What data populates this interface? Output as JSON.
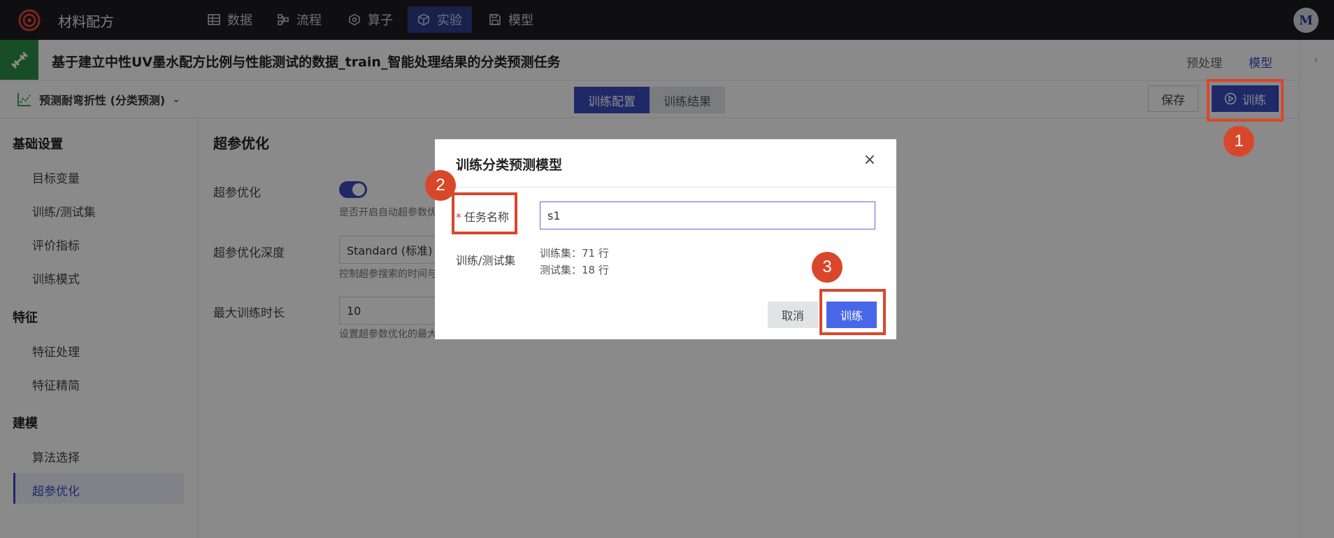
{
  "app": {
    "name": "材料配方",
    "avatar": "M"
  },
  "nav": [
    {
      "label": "数据",
      "icon": "table-icon"
    },
    {
      "label": "流程",
      "icon": "flow-icon"
    },
    {
      "label": "算子",
      "icon": "operator-icon"
    },
    {
      "label": "实验",
      "icon": "cube-icon",
      "active": true
    },
    {
      "label": "模型",
      "icon": "model-icon"
    }
  ],
  "titlebar": {
    "title": "基于建立中性UV墨水配方比例与性能测试的数据_train_智能处理结果的分类预测任务",
    "links": [
      "预处理",
      "模型"
    ],
    "active_link": "模型"
  },
  "toolbar": {
    "task_select": "预测耐弯折性 (分类预测)",
    "tabs": [
      "训练配置",
      "训练结果"
    ],
    "active_tab": "训练配置",
    "save": "保存",
    "train": "训练"
  },
  "sidebar": {
    "groups": [
      {
        "title": "基础设置",
        "items": [
          "目标变量",
          "训练/测试集",
          "评价指标",
          "训练模式"
        ]
      },
      {
        "title": "特征",
        "items": [
          "特征处理",
          "特征精简"
        ]
      },
      {
        "title": "建模",
        "items": [
          "算法选择",
          "超参优化"
        ]
      }
    ],
    "active_item": "超参优化"
  },
  "main": {
    "section_title": "超参优化",
    "fields": [
      {
        "label": "超参优化",
        "hint": "是否开启自动超参数优",
        "toggle_on": true
      },
      {
        "label": "超参优化深度",
        "value": "Standard (标准)",
        "hint": "控制超参搜索的时间与"
      },
      {
        "label": "最大训练时长",
        "value": "10",
        "hint": "设置超参数优化的最大"
      }
    ]
  },
  "modal": {
    "title": "训练分类预测模型",
    "name_label": "任务名称",
    "name_value": "s1",
    "split_label": "训练/测试集",
    "train_info": "训练集：71 行",
    "test_info": "测试集：18 行",
    "cancel": "取消",
    "confirm": "训练"
  },
  "annotations": {
    "colors": {
      "highlight": "#d9472b"
    },
    "steps": [
      "1",
      "2",
      "3"
    ]
  },
  "colors": {
    "accent": "#3a4cc1",
    "nav_bg": "#1c1d22",
    "primary_button": "#4867e8"
  }
}
